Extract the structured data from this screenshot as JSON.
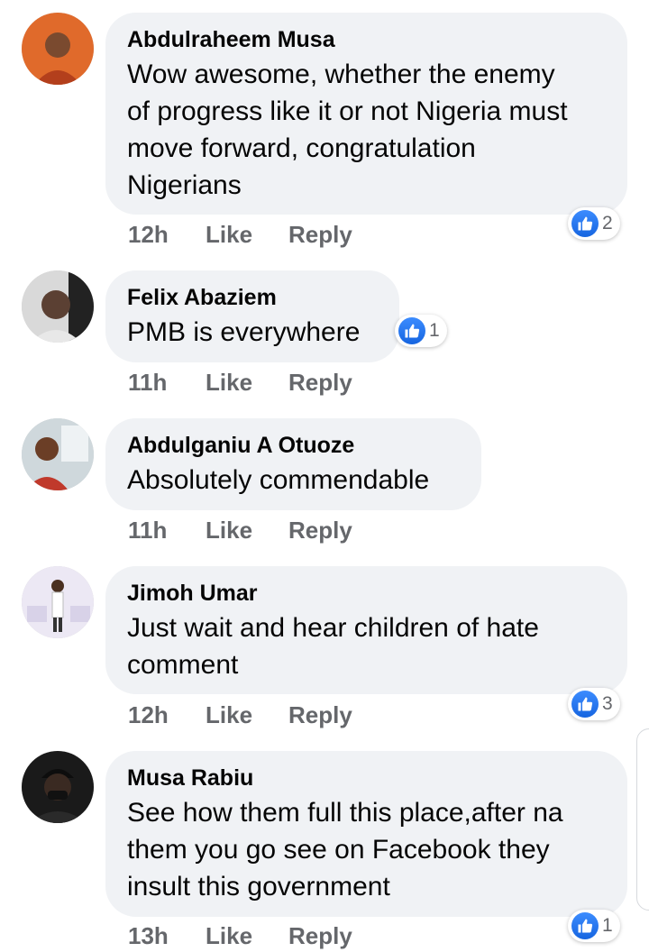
{
  "comments": [
    {
      "author": "Abdulraheem Musa",
      "text": "Wow awesome, whether the enemy\nof progress like it or not Nigeria must\nmove forward, congratulation\nNigerians",
      "time": "12h",
      "like": "Like",
      "reply": "Reply",
      "reactions": "2",
      "avatar_colors": [
        "#e06a2b",
        "#b33f1c"
      ]
    },
    {
      "author": "Felix Abaziem",
      "text": "PMB is everywhere",
      "time": "11h",
      "like": "Like",
      "reply": "Reply",
      "reactions": "1",
      "avatar_colors": [
        "#d9d9d9",
        "#5b4033"
      ]
    },
    {
      "author": "Abdulganiu A Otuoze",
      "text": "Absolutely commendable",
      "time": "11h",
      "like": "Like",
      "reply": "Reply",
      "avatar_colors": [
        "#cfd8dc",
        "#c0392b"
      ]
    },
    {
      "author": "Jimoh Umar",
      "text": "Just wait and hear children of hate\ncomment",
      "time": "12h",
      "like": "Like",
      "reply": "Reply",
      "reactions": "3",
      "avatar_colors": [
        "#ece8f4",
        "#8a7fb0"
      ]
    },
    {
      "author": "Musa Rabiu",
      "text": "See how them full this place,after na\nthem you go see on Facebook they\ninsult this government",
      "time": "13h",
      "like": "Like",
      "reply": "Reply",
      "reactions": "1",
      "avatar_colors": [
        "#1a1a1a",
        "#3a2a22"
      ]
    }
  ],
  "colors": {
    "bubble": "#f0f2f5",
    "meta_text": "#65676b",
    "like_blue": "#1877f2"
  }
}
